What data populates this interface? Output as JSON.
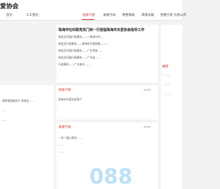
{
  "header": {
    "logo_text": "爱协会"
  },
  "nav": [
    {
      "label": "首页",
      "active": false
    },
    {
      "label": "义工登记",
      "active": false
    },
    {
      "label": "协会介绍",
      "active": true
    },
    {
      "label": "关爱行动",
      "active": false
    },
    {
      "label": "慈善救助",
      "active": false
    },
    {
      "label": "政策法规",
      "active": false
    },
    {
      "label": "党建引领",
      "active": false
    },
    {
      "label": "信息公开",
      "active": false
    }
  ],
  "news": {
    "headline": "珠海市社科联党员门到一行莅临珠海市关爱协会指导工作",
    "items": [
      "新会员开展行政事务——一珠海市华……",
      "新会员行政事务——珠海市关爱助教——一",
      "新会员开展行政事务——广东考核……",
      "新会员开展行政事务——广东省……",
      "行政事务——广东某市……"
    ]
  },
  "left_items": [
    "请帮助困难孩子 珠海全……",
    "……",
    "……"
  ],
  "intro_panel": {
    "title": "协会介绍",
    "more": "MORE",
    "item": "珠海市关爱协会简介"
  },
  "care_panel": {
    "title": "关爱行动",
    "more": "MORE",
    "lines": [
      "一对一爱心帮扶……",
      "……",
      "……"
    ]
  },
  "right_panel": {
    "title": "推荐",
    "quote_prefix": "”",
    "quotes": [
      "……",
      "……",
      "……"
    ]
  },
  "watermark_text": "088"
}
